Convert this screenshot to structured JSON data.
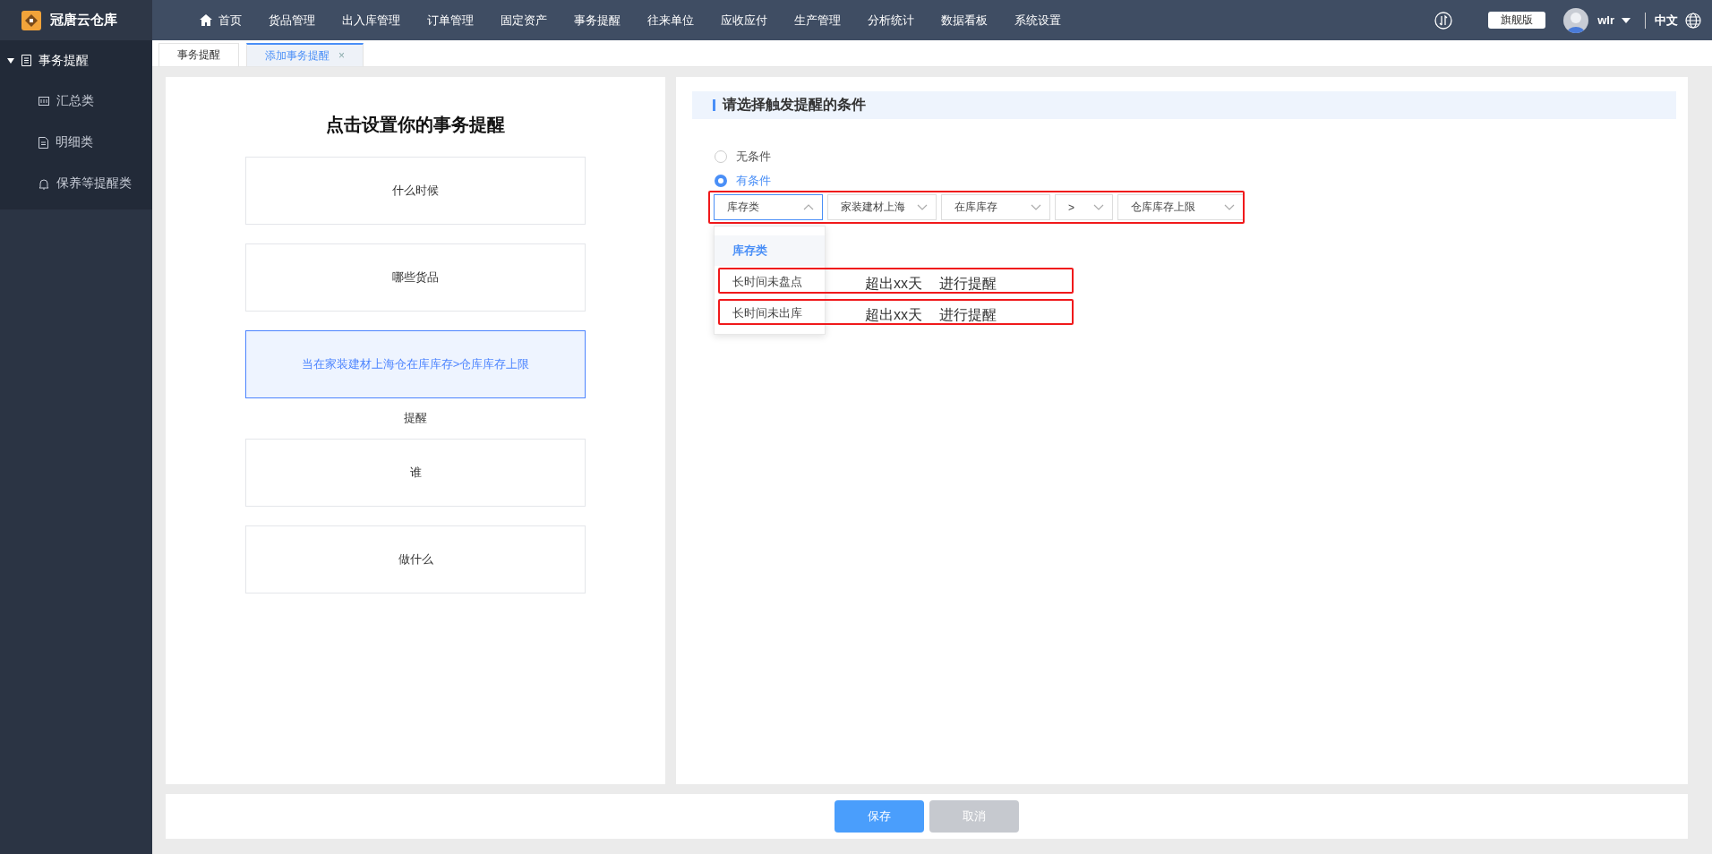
{
  "app": {
    "logo": "冠唐云仓库"
  },
  "nav": [
    {
      "label": "首页",
      "kind": "home"
    },
    {
      "label": "货品管理",
      "kind": "link"
    },
    {
      "label": "出入库管理",
      "kind": "link"
    },
    {
      "label": "订单管理",
      "kind": "link"
    },
    {
      "label": "固定资产",
      "kind": "link"
    },
    {
      "label": "事务提醒",
      "kind": "link"
    },
    {
      "label": "往来单位",
      "kind": "link"
    },
    {
      "label": "应收应付",
      "kind": "link"
    },
    {
      "label": "生产管理",
      "kind": "link"
    },
    {
      "label": "分析统计",
      "kind": "link"
    },
    {
      "label": "数据看板",
      "kind": "link"
    },
    {
      "label": "系统设置",
      "kind": "link"
    }
  ],
  "header_right": {
    "edition": "旗舰版",
    "user": "wlr",
    "language": "中文",
    "language_selected": true
  },
  "sidebar": {
    "label": "事务提醒",
    "expanded": true,
    "children": [
      {
        "label": "汇总类",
        "kind": "summary"
      },
      {
        "label": "明细类",
        "kind": "detail"
      },
      {
        "label": "保养等提醒类",
        "kind": "bell"
      }
    ]
  },
  "tabs": [
    {
      "label": "事务提醒",
      "selected": false
    },
    {
      "label": "添加事务提醒",
      "selected": true,
      "close": "×"
    }
  ],
  "setup": {
    "title": "点击设置你的事务提醒",
    "steps": [
      {
        "kind": "card",
        "label": "什么时候",
        "selected": false
      },
      {
        "kind": "card",
        "label": "哪些货品",
        "selected": false
      },
      {
        "kind": "card",
        "label": "当在家装建材上海仓在库库存>仓库库存上限",
        "selected": true
      },
      {
        "kind": "caption",
        "label": "提醒"
      },
      {
        "kind": "card",
        "label": "谁",
        "selected": false
      },
      {
        "kind": "card",
        "label": "做什么",
        "selected": false
      }
    ]
  },
  "condition": {
    "heading": "请选择触发提醒的条件",
    "options": [
      {
        "label": "无条件",
        "selected": false
      },
      {
        "label": "有条件",
        "selected": true
      }
    ],
    "highlighted": true,
    "selects": [
      {
        "value": "库存类",
        "open": true
      },
      {
        "value": "家装建材上海",
        "open": false
      },
      {
        "value": "在库库存",
        "open": false
      },
      {
        "value": ">",
        "open": false
      },
      {
        "value": "仓库库存上限",
        "open": false
      }
    ],
    "dropdown": {
      "group": "库存类",
      "items": [
        {
          "label": "长时间未盘点",
          "highlighted": true,
          "note": "超出xx天",
          "action": "进行提醒"
        },
        {
          "label": "长时间未出库",
          "highlighted": true,
          "note": "超出xx天",
          "action": "进行提醒"
        }
      ]
    }
  },
  "buttons": [
    {
      "label": "保存",
      "disabled": false
    },
    {
      "label": "取消",
      "disabled": true
    }
  ]
}
